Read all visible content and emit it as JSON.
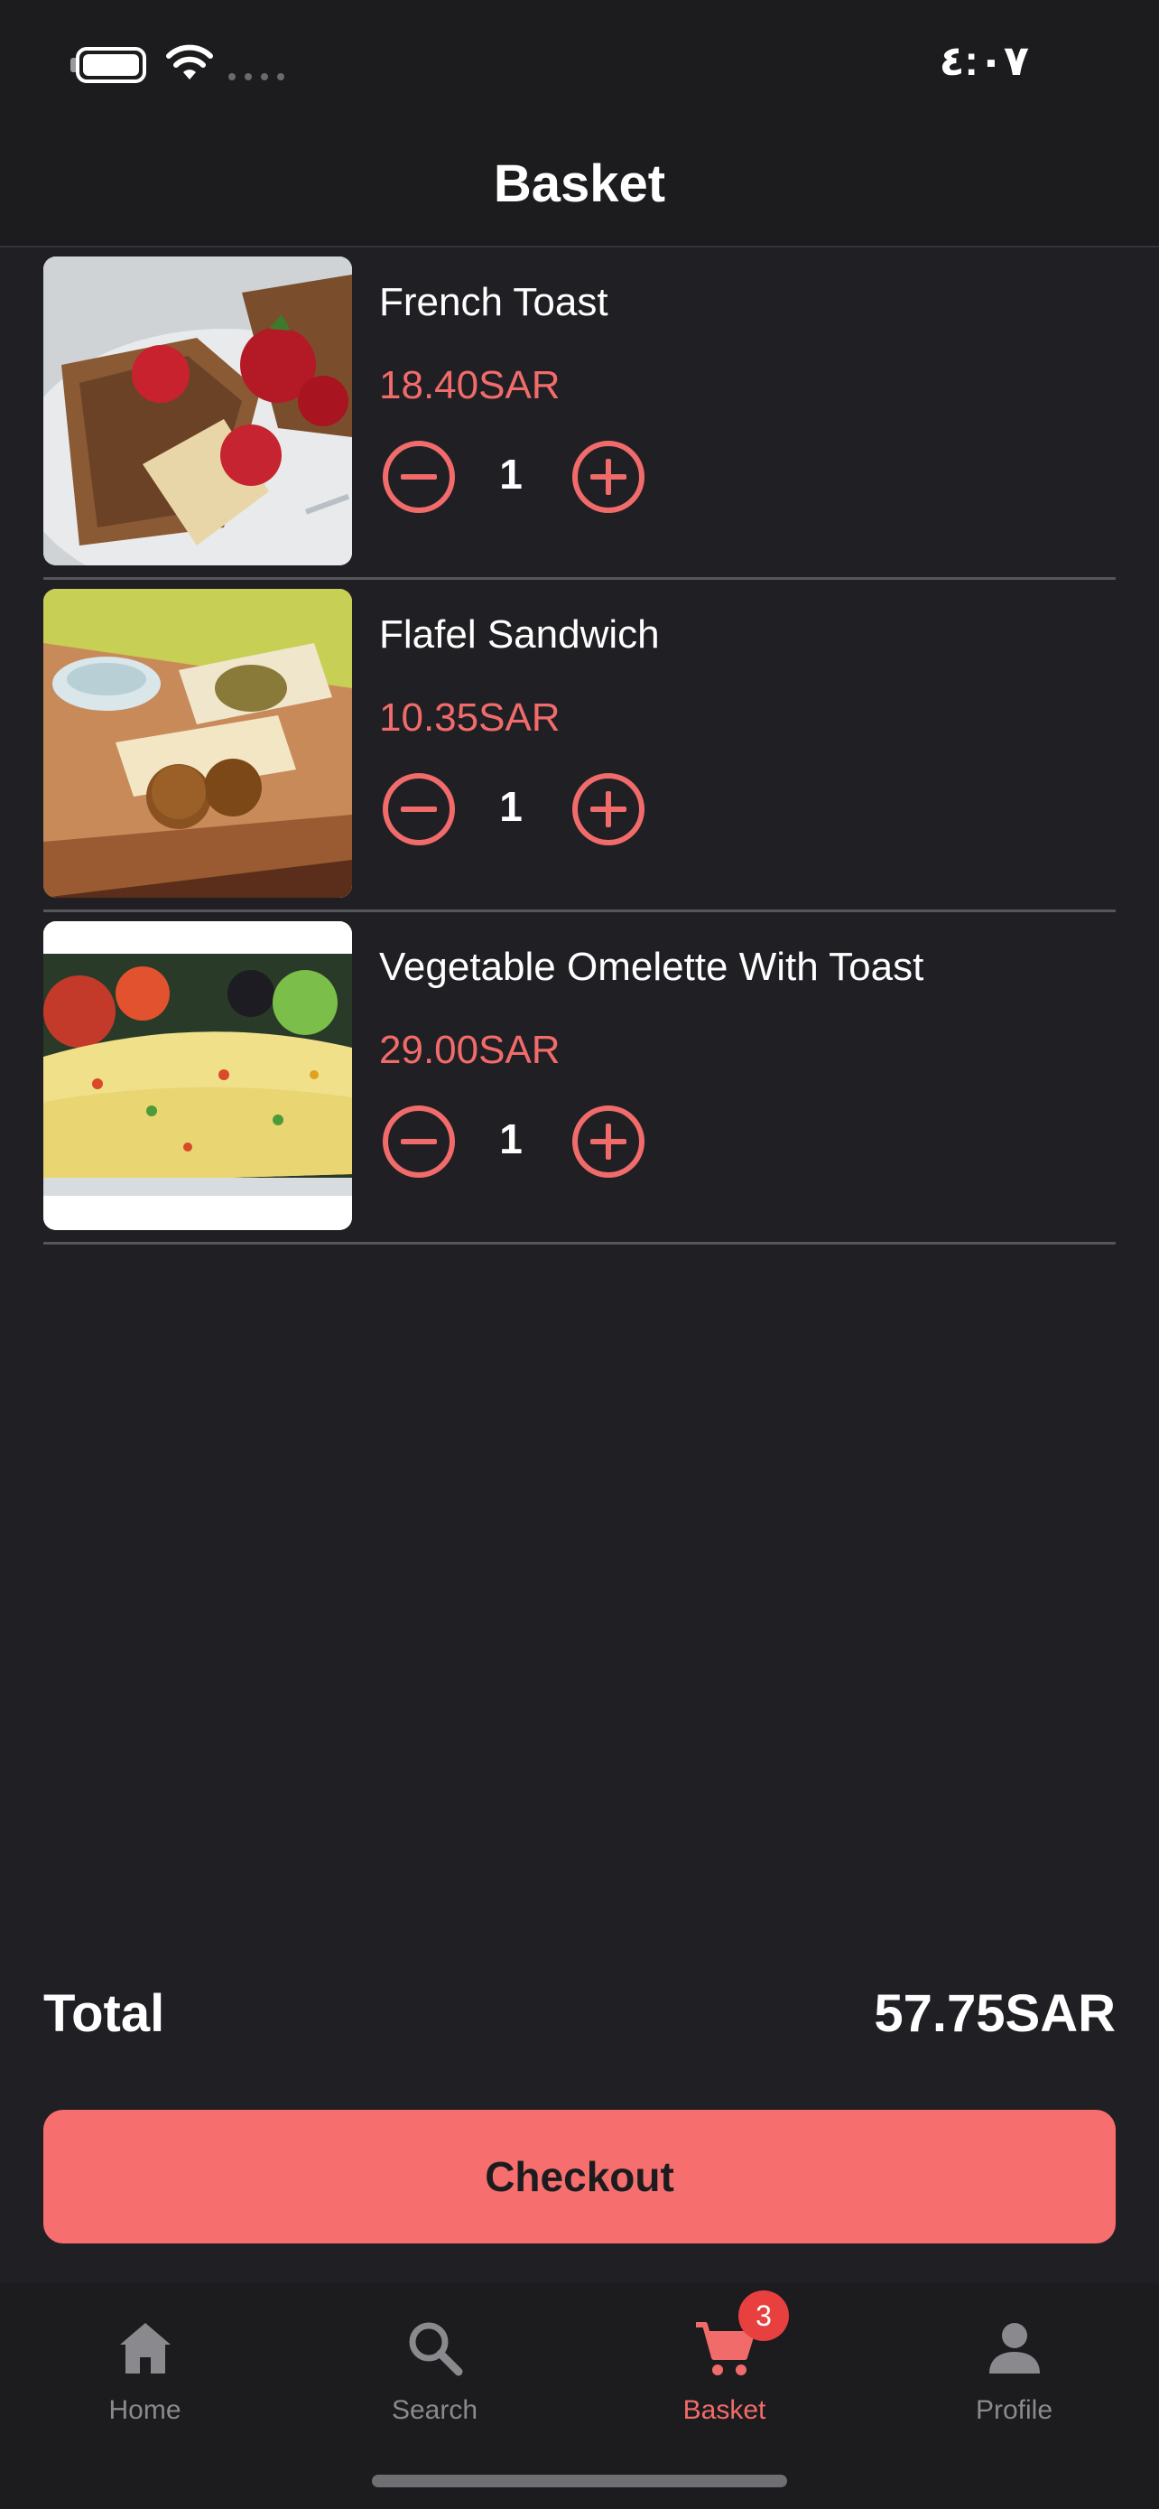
{
  "status_bar": {
    "time": "٤:٠٧"
  },
  "header": {
    "title": "Basket"
  },
  "items": [
    {
      "name": "French Toast",
      "price": "18.40SAR",
      "quantity": "1",
      "image_icon": "french-toast-photo"
    },
    {
      "name": "Flafel Sandwich",
      "price": "10.35SAR",
      "quantity": "1",
      "image_icon": "falafel-sandwich-photo"
    },
    {
      "name": "Vegetable Omelette With Toast",
      "price": "29.00SAR",
      "quantity": "1",
      "image_icon": "omelette-photo"
    }
  ],
  "summary": {
    "total_label": "Total",
    "total_value": "57.75SAR"
  },
  "checkout": {
    "label": "Checkout"
  },
  "tabs": [
    {
      "label": "Home",
      "icon": "home-icon",
      "active": false
    },
    {
      "label": "Search",
      "icon": "search-icon",
      "active": false
    },
    {
      "label": "Basket",
      "icon": "cart-icon",
      "active": true,
      "badge": "3"
    },
    {
      "label": "Profile",
      "icon": "person-icon",
      "active": false
    }
  ],
  "colors": {
    "background": "#202024",
    "accent": "#f76e6e",
    "price": "#f26b6b",
    "badge": "#e8403f",
    "inactive_tab": "#8a8a8e"
  }
}
